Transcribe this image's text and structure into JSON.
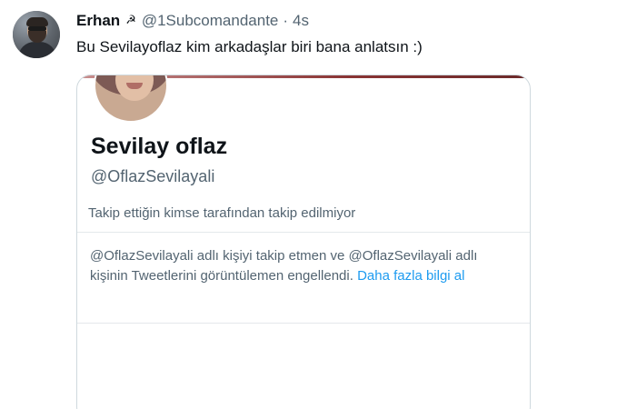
{
  "tweet": {
    "author_name": "Erhan",
    "author_emoji": "☭",
    "author_handle": "@1Subcomandante",
    "separator": "·",
    "time": "4s",
    "text": "Bu Sevilayoflaz kim arkadaşlar biri bana anlatsın :)"
  },
  "card": {
    "display_name": "Sevilay oflaz",
    "handle": "@OflazSevilayali",
    "follow_note": "Takip ettiğin kimse tarafından takip edilmiyor",
    "blocked_text": "@OflazSevilayali adlı kişiyi takip etmen ve @OflazSevilayali adlı kişinin Tweetlerini görüntülemen engellendi.",
    "learn_more": "Daha fazla bilgi al"
  },
  "colors": {
    "text_primary": "#0f1419",
    "text_secondary": "#536471",
    "link": "#1d9bf0",
    "border": "#cfd9de"
  }
}
